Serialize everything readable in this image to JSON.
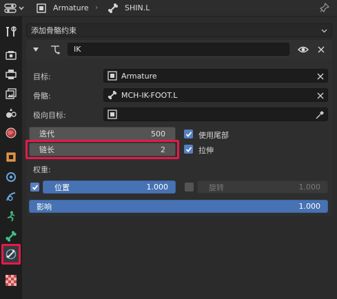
{
  "header": {
    "object_name": "Armature",
    "bone_name": "SHIN.L"
  },
  "sidebar": {
    "tabs": [
      {
        "name": "tool-icon"
      },
      {
        "name": "render-icon"
      },
      {
        "name": "output-icon"
      },
      {
        "name": "view-layer-icon"
      },
      {
        "name": "scene-icon"
      },
      {
        "name": "world-icon"
      },
      {
        "name": "object-icon"
      },
      {
        "name": "modifier-icon"
      },
      {
        "name": "particles-icon"
      },
      {
        "name": "physics-icon"
      },
      {
        "name": "bone-icon"
      },
      {
        "name": "bone-constraint-icon"
      },
      {
        "name": "texture-icon"
      }
    ]
  },
  "add_constraint_label": "添加骨骼约束",
  "constraint": {
    "name": "IK",
    "target_label": "目标:",
    "target_value": "Armature",
    "bone_label": "骨骼:",
    "bone_value": "MCH-IK-FOOT.L",
    "pole_label": "极向目标:",
    "pole_value": "",
    "iterations_label": "迭代",
    "iterations_value": "500",
    "chain_label": "链长",
    "chain_value": "2",
    "use_tail_label": "使用尾部",
    "stretch_label": "拉伸",
    "weight_label": "权重:",
    "position_label": "位置",
    "position_value": "1.000",
    "rotation_label": "旋转",
    "rotation_value": "1.000",
    "influence_label": "影响",
    "influence_value": "1.000"
  },
  "colors": {
    "accent": "#4772b3",
    "highlight": "#e8194a"
  }
}
